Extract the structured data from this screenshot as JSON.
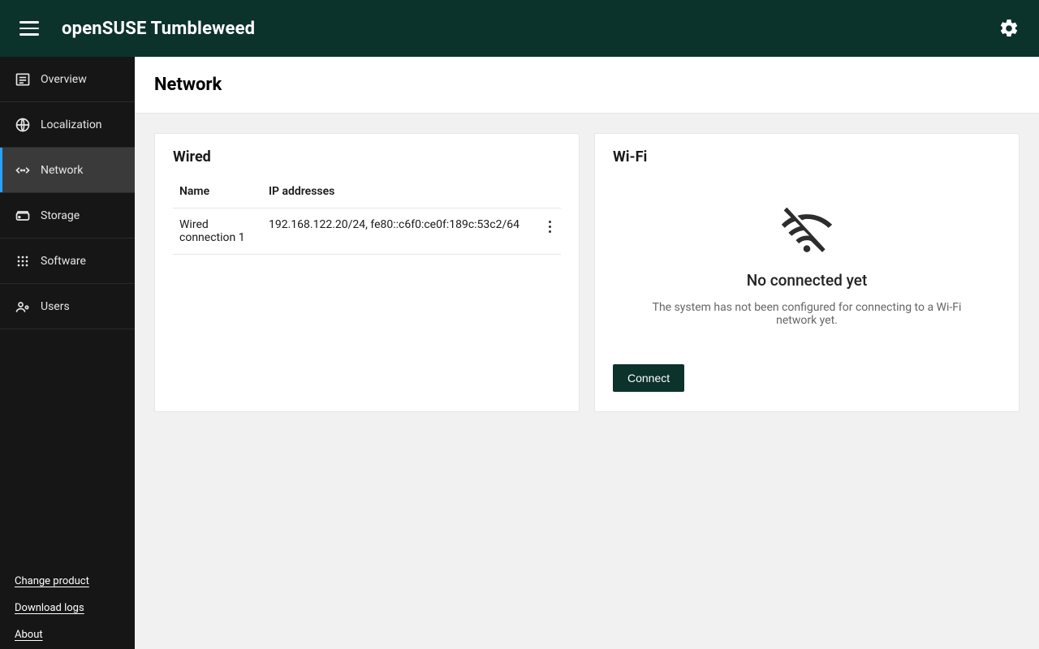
{
  "header": {
    "title": "openSUSE Tumbleweed"
  },
  "sidebar": {
    "items": [
      {
        "label": "Overview"
      },
      {
        "label": "Localization"
      },
      {
        "label": "Network"
      },
      {
        "label": "Storage"
      },
      {
        "label": "Software"
      },
      {
        "label": "Users"
      }
    ],
    "active_index": 2,
    "footer_links": [
      {
        "label": "Change product"
      },
      {
        "label": "Download logs"
      },
      {
        "label": "About"
      }
    ]
  },
  "page": {
    "title": "Network"
  },
  "wired": {
    "heading": "Wired",
    "columns": {
      "name": "Name",
      "ip": "IP addresses"
    },
    "rows": [
      {
        "name": "Wired connection 1",
        "ip": "192.168.122.20/24, fe80::c6f0:ce0f:189c:53c2/64"
      }
    ]
  },
  "wifi": {
    "heading": "Wi-Fi",
    "empty_title": "No connected yet",
    "empty_desc": "The system has not been configured for connecting to a Wi-Fi network yet.",
    "connect_label": "Connect"
  }
}
